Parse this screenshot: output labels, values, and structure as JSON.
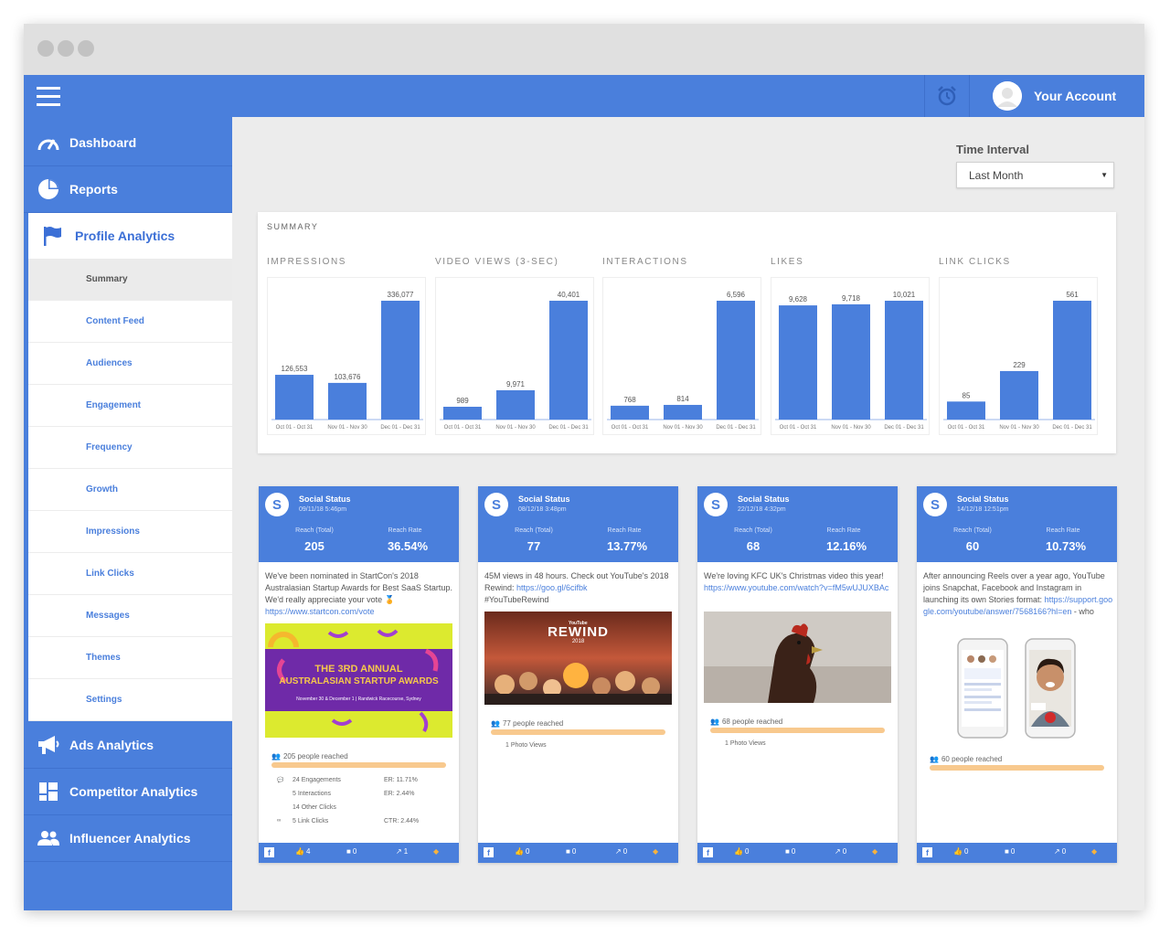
{
  "nav": {
    "dashboard": "Dashboard",
    "reports": "Reports",
    "profile_analytics": "Profile Analytics",
    "sub_items": [
      "Summary",
      "Content Feed",
      "Audiences",
      "Engagement",
      "Frequency",
      "Growth",
      "Impressions",
      "Link Clicks",
      "Messages",
      "Themes",
      "Settings"
    ],
    "ads_analytics": "Ads Analytics",
    "competitor_analytics": "Competitor Analytics",
    "influencer_analytics": "Influencer Analytics"
  },
  "topbar": {
    "account_label": "Your Account",
    "alarm_icon": "alarm-clock-icon"
  },
  "filter": {
    "label": "Time Interval",
    "selected": "Last Month"
  },
  "summary": {
    "title": "SUMMARY"
  },
  "colors": {
    "brand": "#4a7fdc",
    "bar": "#4a7fdc",
    "reach": "#f8c98e",
    "accent": "#f6b23e"
  },
  "chart_data": [
    {
      "type": "bar",
      "title": "IMPRESSIONS",
      "categories": [
        "Oct 01 - Oct 31",
        "Nov 01 - Nov 30",
        "Dec 01 - Dec 31"
      ],
      "values": [
        126553,
        103676,
        336077
      ],
      "labels": [
        "126,553",
        "103,676",
        "336,077"
      ]
    },
    {
      "type": "bar",
      "title": "VIDEO VIEWS (3-SEC)",
      "categories": [
        "Oct 01 - Oct 31",
        "Nov 01 - Nov 30",
        "Dec 01 - Dec 31"
      ],
      "values": [
        989,
        9971,
        40401
      ],
      "labels": [
        "989",
        "9,971",
        "40,401"
      ]
    },
    {
      "type": "bar",
      "title": "INTERACTIONS",
      "categories": [
        "Oct 01 - Oct 31",
        "Nov 01 - Nov 30",
        "Dec 01 - Dec 31"
      ],
      "values": [
        768,
        814,
        6596
      ],
      "labels": [
        "768",
        "814",
        "6,596"
      ]
    },
    {
      "type": "bar",
      "title": "LIKES",
      "categories": [
        "Oct 01 - Oct 31",
        "Nov 01 - Nov 30",
        "Dec 01 - Dec 31"
      ],
      "values": [
        9628,
        9718,
        10021
      ],
      "labels": [
        "9,628",
        "9,718",
        "10,021"
      ]
    },
    {
      "type": "bar",
      "title": "LINK CLICKS",
      "categories": [
        "Oct 01 - Oct 31",
        "Nov 01 - Nov 30",
        "Dec 01 - Dec 31"
      ],
      "values": [
        85,
        229,
        561
      ],
      "labels": [
        "85",
        "229",
        "561"
      ]
    }
  ],
  "posts": [
    {
      "title": "Social Status",
      "date": "09/11/18 5:46pm",
      "reach_label": "Reach (Total)",
      "reach_value": "205",
      "rate_label": "Reach Rate",
      "rate_value": "36.54%",
      "text": "We've been nominated in StartCon's 2018 Australasian Startup Awards for Best SaaS Startup. We'd really appreciate your vote 🏅",
      "link": "https://www.startcon.com/vote",
      "image": {
        "line1": "THE 3RD ANNUAL",
        "line2": "AUSTRALASIAN STARTUP AWARDS",
        "line3": "November 30 & December 1 | Randwick Racecourse, Sydney"
      },
      "reached": "205 people reached",
      "engagements": [
        {
          "label": "24 Engagements",
          "metric": "ER: 11.71%"
        },
        {
          "label": "5 Interactions",
          "metric": "ER: 2.44%"
        },
        {
          "label": "14 Other Clicks",
          "metric": ""
        },
        {
          "label": "5 Link Clicks",
          "metric": "CTR: 2.44%"
        }
      ],
      "footer": {
        "likes": "4",
        "comments": "0",
        "shares": "1"
      }
    },
    {
      "title": "Social Status",
      "date": "08/12/18 3:48pm",
      "reach_label": "Reach (Total)",
      "reach_value": "77",
      "rate_label": "Reach Rate",
      "rate_value": "13.77%",
      "text": "45M views in 48 hours. Check out YouTube's 2018 Rewind:",
      "link": "https://goo.gl/6cifbk",
      "text_after": "#YouTubeRewind",
      "image": {
        "line1": "REWIND",
        "line2": "2018",
        "line3": "YouTube"
      },
      "reached": "77 people reached",
      "stat": "1 Photo Views",
      "footer": {
        "likes": "0",
        "comments": "0",
        "shares": "0"
      }
    },
    {
      "title": "Social Status",
      "date": "22/12/18 4:32pm",
      "reach_label": "Reach (Total)",
      "reach_value": "68",
      "rate_label": "Reach Rate",
      "rate_value": "12.16%",
      "text": "We're loving KFC UK's Christmas video this year!",
      "link": "https://www.youtube.com/watch?v=fM5wUJUXBAc",
      "reached": "68 people reached",
      "stat": "1 Photo Views",
      "footer": {
        "likes": "0",
        "comments": "0",
        "shares": "0"
      }
    },
    {
      "title": "Social Status",
      "date": "14/12/18 12:51pm",
      "reach_label": "Reach (Total)",
      "reach_value": "60",
      "rate_label": "Reach Rate",
      "rate_value": "10.73%",
      "text": "After announcing Reels over a year ago, YouTube joins Snapchat, Facebook and Instagram in launching its own Stories format:",
      "link": "https://support.google.com/youtube/answer/7568166?hl=en",
      "text_after": " - who",
      "reached": "60 people reached",
      "footer": {
        "likes": "0",
        "comments": "0",
        "shares": "0"
      }
    }
  ]
}
